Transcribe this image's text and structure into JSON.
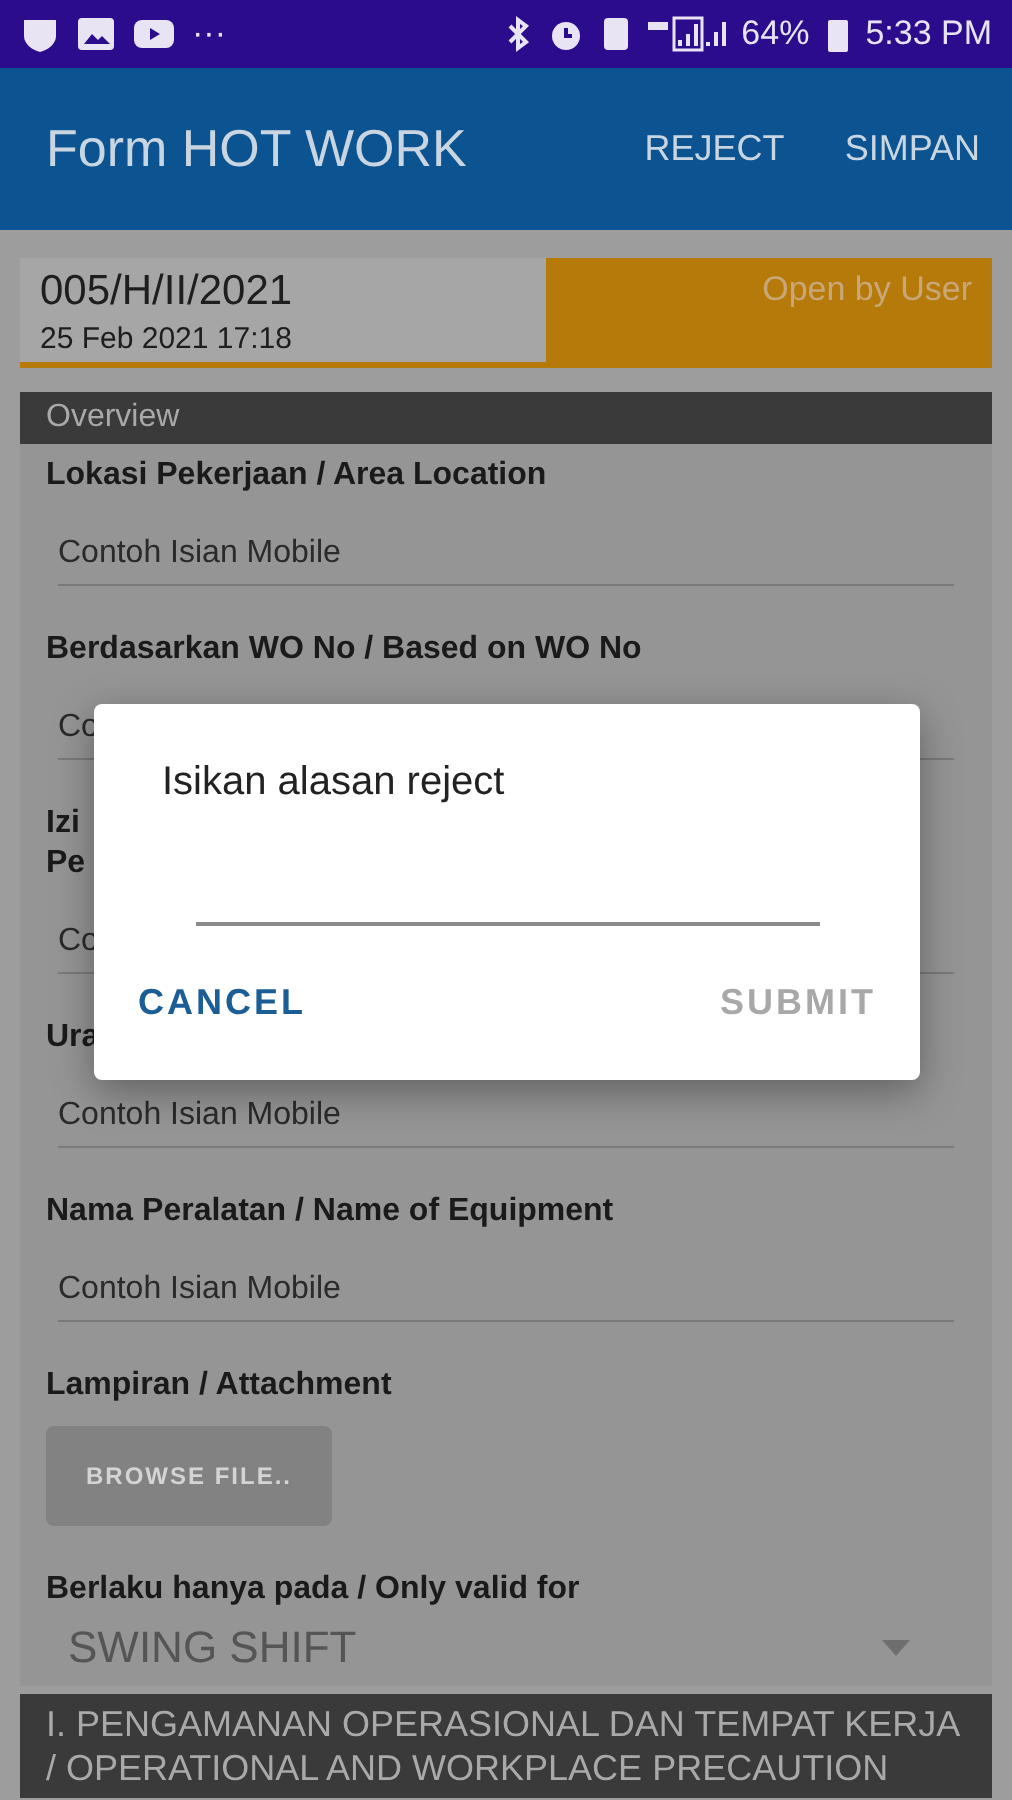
{
  "status_bar": {
    "battery": "64%",
    "time": "5:33 PM",
    "more": "···"
  },
  "app_bar": {
    "title": "Form HOT WORK",
    "actions": [
      "REJECT",
      "SIMPAN"
    ]
  },
  "record": {
    "number": "005/H/II/2021",
    "date": "25 Feb 2021 17:18",
    "status": "Open by User"
  },
  "overview": {
    "title": "Overview",
    "fields": [
      {
        "label": "Lokasi Pekerjaan / Area Location",
        "value": "Contoh Isian Mobile"
      },
      {
        "label": "Berdasarkan WO No / Based on WO No",
        "value": "Co"
      },
      {
        "label": "Izi\nPe",
        "value": "Co"
      },
      {
        "label": "Ura",
        "value": "Contoh Isian Mobile"
      },
      {
        "label": "Nama Peralatan / Name of Equipment",
        "value": "Contoh Isian Mobile"
      }
    ],
    "attachment": {
      "label": "Lampiran / Attachment",
      "button": "BROWSE FILE.."
    },
    "valid_for": {
      "label": "Berlaku hanya pada / Only valid for",
      "value": "SWING SHIFT"
    }
  },
  "next_section": {
    "title": "I. PENGAMANAN OPERASIONAL DAN TEMPAT KERJA / OPERATIONAL AND WORKPLACE PRECAUTION"
  },
  "dialog": {
    "title": "Isikan alasan reject",
    "buttons": [
      {
        "label": "CANCEL",
        "disabled": false
      },
      {
        "label": "SUBMIT",
        "disabled": true
      }
    ]
  }
}
